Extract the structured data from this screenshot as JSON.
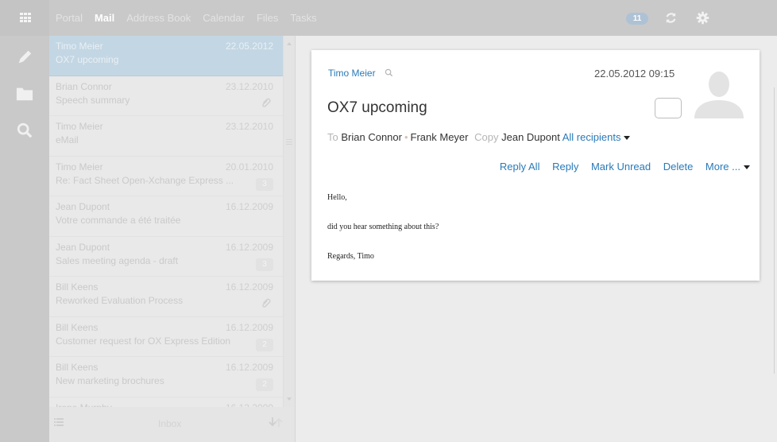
{
  "nav": {
    "tabs": [
      {
        "label": "Portal",
        "active": false
      },
      {
        "label": "Mail",
        "active": true
      },
      {
        "label": "Address Book",
        "active": false
      },
      {
        "label": "Calendar",
        "active": false
      },
      {
        "label": "Files",
        "active": false
      },
      {
        "label": "Tasks",
        "active": false
      }
    ],
    "notification_count": "11",
    "icons": [
      "app-launcher-icon",
      "refresh-icon",
      "gear-icon"
    ]
  },
  "sidebar": {
    "icons": [
      "compose-pencil-icon",
      "folder-icon",
      "search-icon"
    ]
  },
  "mail_list": {
    "items": [
      {
        "from": "Timo Meier",
        "date": "22.05.2012",
        "subject": "OX7 upcoming",
        "selected": true
      },
      {
        "from": "Brian Connor",
        "date": "23.12.2010",
        "subject": "Speech summary",
        "attachment": true
      },
      {
        "from": "Timo Meier",
        "date": "23.12.2010",
        "subject": "eMail"
      },
      {
        "from": "Timo Meier",
        "date": "20.01.2010",
        "subject": "Re: Fact Sheet Open-Xchange Express ...",
        "count": "3"
      },
      {
        "from": "Jean Dupont",
        "date": "16.12.2009",
        "subject": "Votre commande a été traitée"
      },
      {
        "from": "Jean Dupont",
        "date": "16.12.2009",
        "subject": "Sales meeting agenda - draft",
        "count": "3"
      },
      {
        "from": "Bill Keens",
        "date": "16.12.2009",
        "subject": "Reworked Evaluation Process",
        "attachment": true
      },
      {
        "from": "Bill Keens",
        "date": "16.12.2009",
        "subject": "Customer request for OX Express Edition",
        "count": "2"
      },
      {
        "from": "Bill Keens",
        "date": "16.12.2009",
        "subject": "New marketing brochures",
        "count": "2"
      },
      {
        "from": "Irene Murphy",
        "date": "16.12.2009",
        "subject": ""
      }
    ],
    "footer": {
      "folder": "Inbox"
    }
  },
  "detail": {
    "sender": "Timo Meier",
    "date": "22.05.2012 09:15",
    "subject": "OX7 upcoming",
    "to_label": "To",
    "to": [
      "Brian Connor",
      "Frank Meyer"
    ],
    "copy_label": "Copy",
    "copy": "Jean Dupont",
    "all_recipients": "All recipients",
    "actions": {
      "reply_all": "Reply All",
      "reply": "Reply",
      "mark_unread": "Mark Unread",
      "delete": "Delete",
      "more": "More ..."
    },
    "body": [
      "Hello,",
      "did you hear something about this?",
      "Regards, Timo"
    ]
  }
}
